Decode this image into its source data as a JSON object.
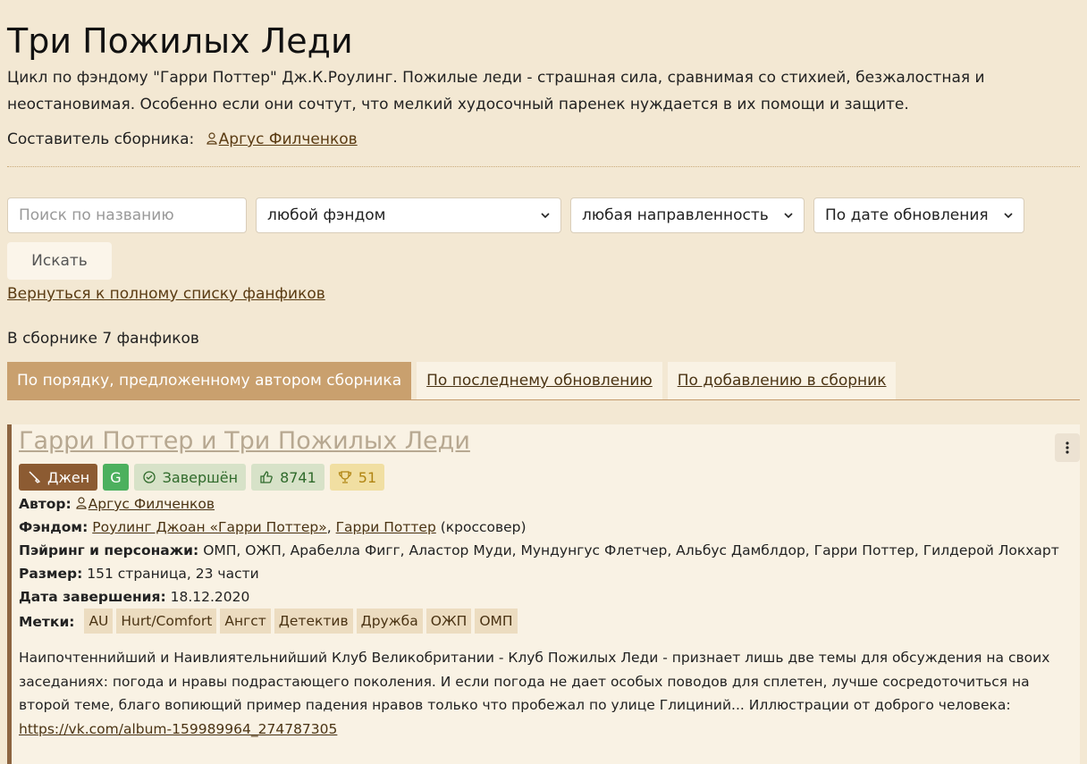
{
  "page": {
    "title": "Три Пожилых Леди",
    "description": "Цикл по фэндому \"Гарри Поттер\" Дж.К.Роулинг. Пожилые леди - страшная сила, сравнимая со стихией, безжалостная и неостановимая. Особенно если они сочтут, что мелкий худосочный паренек нуждается в их помощи и защите.",
    "compiler_label": "Составитель сборника:",
    "compiler_name": "Аргус Филченков"
  },
  "filters": {
    "search_placeholder": "Поиск по названию",
    "fandom_selected": "любой фэндом",
    "direction_selected": "любая направленность",
    "sort_selected": "По дате обновления",
    "search_button": "Искать",
    "back_link": "Вернуться к полному списку фанфиков"
  },
  "collection": {
    "count_text": "В сборнике 7 фанфиков",
    "tabs": [
      {
        "label": "По порядку, предложенному автором сборника",
        "active": true
      },
      {
        "label": "По последнему обновлению",
        "active": false
      },
      {
        "label": "По добавлению в сборник",
        "active": false
      }
    ]
  },
  "fic": {
    "title": "Гарри Поттер и Три Пожилых Леди",
    "direction": "Джен",
    "rating": "G",
    "status": "Завершён",
    "likes": "8741",
    "awards": "51",
    "author_label": "Автор:",
    "author": "Аргус Филченков",
    "fandom_label": "Фэндом:",
    "fandom_1": "Роулинг Джоан «Гарри Поттер»",
    "fandom_sep": ",",
    "fandom_2": "Гарри Поттер",
    "fandom_suffix": "(кроссовер)",
    "pairing_label": "Пэйринг и персонажи:",
    "pairing": "ОМП, ОЖП, Арабелла Фигг, Аластор Муди, Мундунгус Флетчер, Альбус Дамблдор, Гарри Поттер, Гилдерой Локхарт",
    "size_label": "Размер:",
    "size": "151 страница, 23 части",
    "date_label": "Дата завершения:",
    "date": "18.12.2020",
    "tags_label": "Метки:",
    "tags": [
      "AU",
      "Hurt/Comfort",
      "Ангст",
      "Детектив",
      "Дружба",
      "ОЖП",
      "ОМП"
    ],
    "summary": "Наипочтеннийший и Наивлиятельнийший Клуб Великобритании - Клуб Пожилых Леди - признает лишь две темы для обсуждения на своих заседаниях: погода и нравы подрастающего поколения. И если погода не дает особых поводов для сплетен, лучше сосредоточиться на второй теме, благо вопиющий пример падения нравов только что пробежал по улице Глициний... Иллюстрации от доброго человека:",
    "summary_link": "https://vk.com/album-159989964_274787305"
  },
  "colors": {
    "background": "#f3e8d3",
    "accent": "#c9a06e",
    "direction_badge": "#8c5b32",
    "rating_badge": "#4cb05e"
  }
}
